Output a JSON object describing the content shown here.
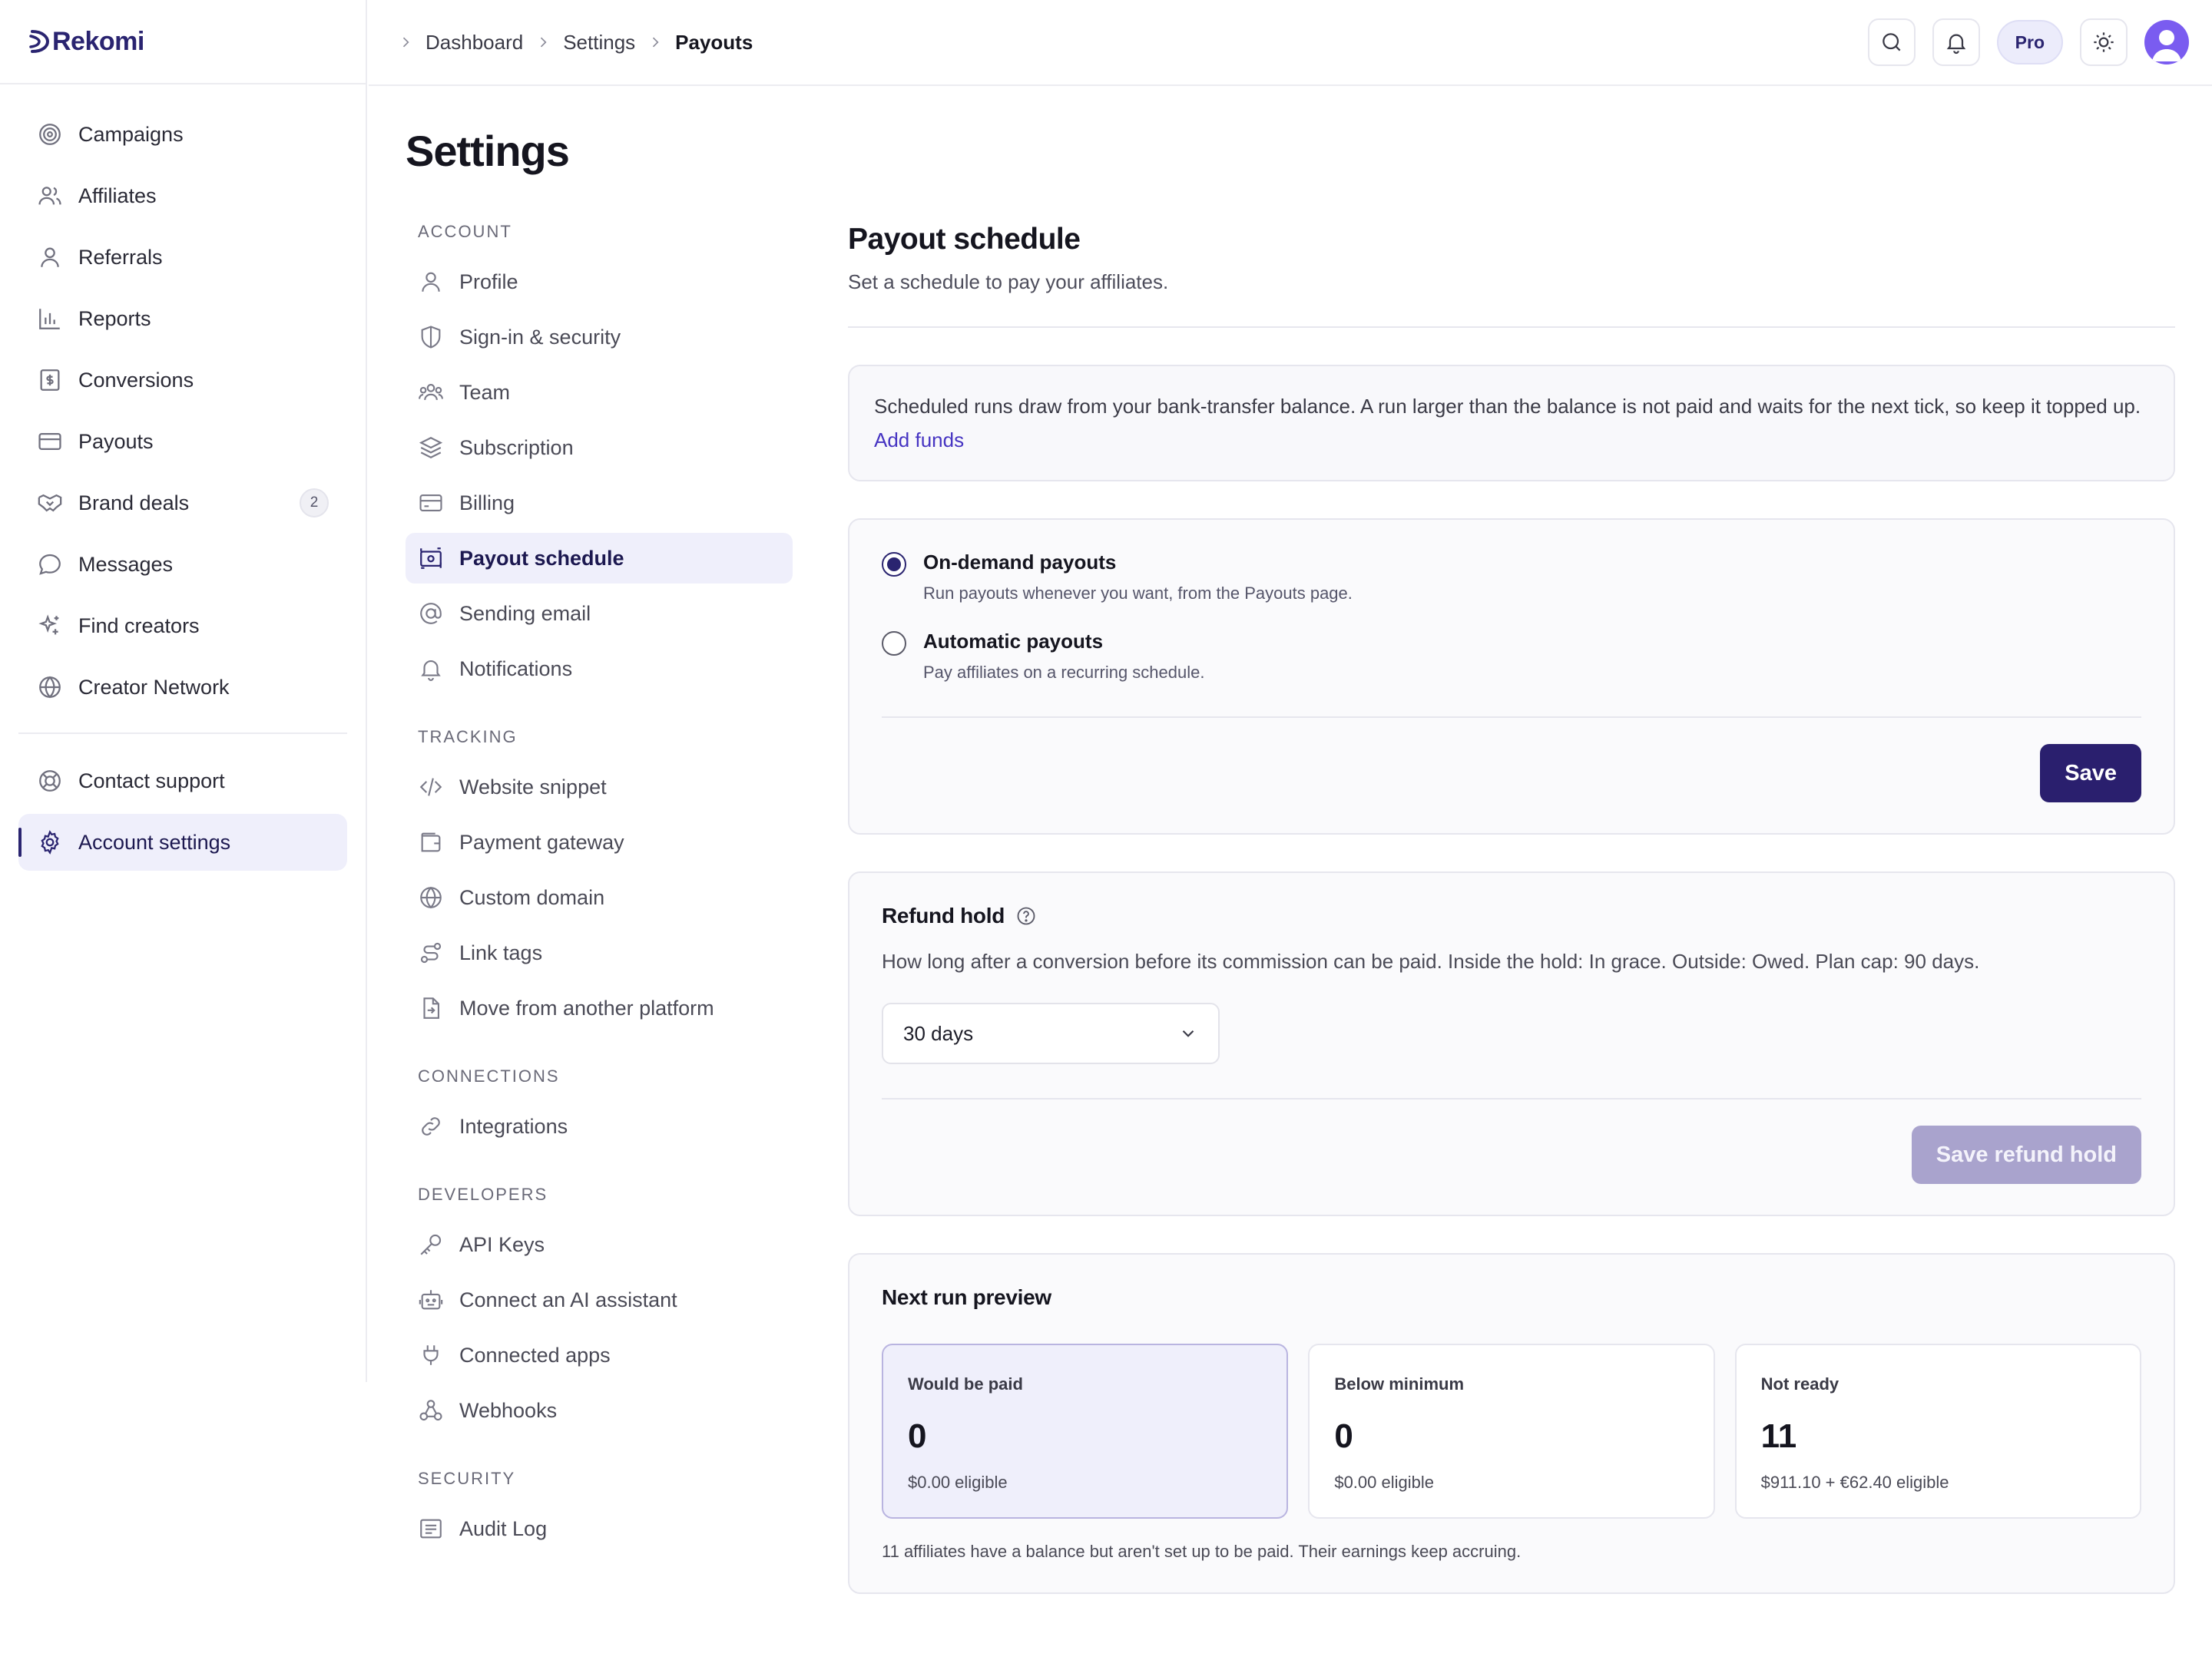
{
  "brand": {
    "name": "Rekomi"
  },
  "sidebar": {
    "items": [
      {
        "label": "Campaigns",
        "icon": "target-icon"
      },
      {
        "label": "Affiliates",
        "icon": "users-icon"
      },
      {
        "label": "Referrals",
        "icon": "user-icon"
      },
      {
        "label": "Reports",
        "icon": "bar-chart-icon"
      },
      {
        "label": "Conversions",
        "icon": "receipt-icon"
      },
      {
        "label": "Payouts",
        "icon": "credit-card-icon"
      },
      {
        "label": "Brand deals",
        "icon": "handshake-icon",
        "badge": "2"
      },
      {
        "label": "Messages",
        "icon": "message-icon"
      },
      {
        "label": "Find creators",
        "icon": "sparkles-icon"
      },
      {
        "label": "Creator Network",
        "icon": "globe-icon"
      }
    ],
    "bottom_items": [
      {
        "label": "Contact support",
        "icon": "lifebuoy-icon"
      },
      {
        "label": "Account settings",
        "icon": "gear-icon",
        "active": true
      }
    ]
  },
  "topbar": {
    "breadcrumbs": [
      "Dashboard",
      "Settings",
      "Payouts"
    ],
    "plan_badge": "Pro"
  },
  "settings": {
    "title": "Settings",
    "groups": [
      {
        "label": "ACCOUNT",
        "items": [
          "Profile",
          "Sign-in & security",
          "Team",
          "Subscription",
          "Billing",
          "Payout schedule",
          "Sending email",
          "Notifications"
        ]
      },
      {
        "label": "TRACKING",
        "items": [
          "Website snippet",
          "Payment gateway",
          "Custom domain",
          "Link tags",
          "Move from another platform"
        ]
      },
      {
        "label": "CONNECTIONS",
        "items": [
          "Integrations"
        ]
      },
      {
        "label": "DEVELOPERS",
        "items": [
          "API Keys",
          "Connect an AI assistant",
          "Connected apps",
          "Webhooks"
        ]
      },
      {
        "label": "SECURITY",
        "items": [
          "Audit Log"
        ]
      }
    ],
    "active_item": "Payout schedule"
  },
  "main": {
    "title": "Payout schedule",
    "subtitle": "Set a schedule to pay your affiliates.",
    "notice": {
      "text": "Scheduled runs draw from your bank-transfer balance. A run larger than the balance is not paid and waits for the next tick, so keep it topped up.",
      "link": "Add funds"
    },
    "schedule": {
      "options": [
        {
          "title": "On-demand payouts",
          "desc": "Run payouts whenever you want, from the Payouts page.",
          "selected": true
        },
        {
          "title": "Automatic payouts",
          "desc": "Pay affiliates on a recurring schedule.",
          "selected": false
        }
      ],
      "save_label": "Save"
    },
    "refund_hold": {
      "title": "Refund hold",
      "desc": "How long after a conversion before its commission can be paid. Inside the hold: In grace. Outside: Owed. Plan cap: 90 days.",
      "selected": "30 days",
      "save_label": "Save refund hold"
    },
    "preview": {
      "title": "Next run preview",
      "stats": [
        {
          "label": "Would be paid",
          "value": "0",
          "sub": "$0.00 eligible"
        },
        {
          "label": "Below minimum",
          "value": "0",
          "sub": "$0.00 eligible"
        },
        {
          "label": "Not ready",
          "value": "11",
          "sub": "$911.10 + €62.40 eligible"
        }
      ],
      "note": "11 affiliates have a balance but aren't set up to be paid. Their earnings keep accruing."
    }
  },
  "colors": {
    "accent": "#2a1f6e",
    "accent_soft": "#efeffb",
    "link": "#4634c2",
    "avatar": "#7a5cf0"
  }
}
